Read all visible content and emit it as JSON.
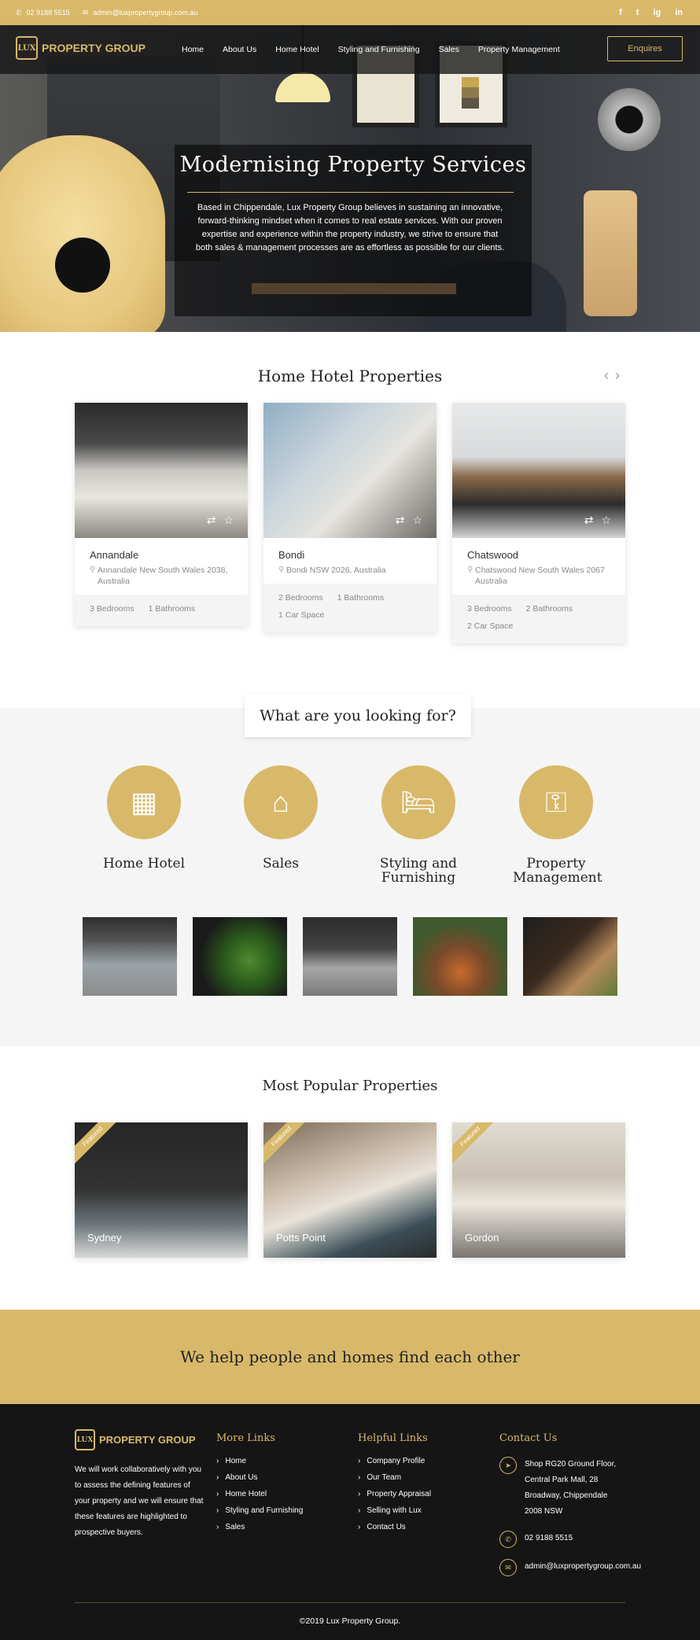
{
  "topbar": {
    "phone": "02 9188 5515",
    "email": "admin@luxpropertygroup.com.au",
    "social": [
      "f",
      "t",
      "ig",
      "in"
    ]
  },
  "header": {
    "logo_mark": "LUX",
    "logo_text": "PROPERTY GROUP",
    "nav": [
      "Home",
      "About Us",
      "Home Hotel",
      "Styling and Furnishing",
      "Sales",
      "Property Management"
    ],
    "cta": "Enquires"
  },
  "hero": {
    "title": "Modernising Property Services",
    "text": "Based in Chippendale, Lux Property Group believes in sustaining an innovative, forward-thinking mindset when it comes to real estate services. With our proven expertise and experience within the property industry, we strive to ensure that both sales & management processes are as effortless as possible for our clients."
  },
  "home_hotel": {
    "title": "Home Hotel Properties",
    "cards": [
      {
        "name": "Annandale",
        "address": "Annandale New South Wales 2038, Australia",
        "features": [
          "3 Bedrooms",
          "1 Bathrooms"
        ]
      },
      {
        "name": "Bondi",
        "address": "Bondi NSW 2026, Australia",
        "features": [
          "2 Bedrooms",
          "1 Bathrooms",
          "1 Car Space"
        ]
      },
      {
        "name": "Chatswood",
        "address": "Chatswood New South Wales 2067 Australia",
        "features": [
          "3 Bedrooms",
          "2 Bathrooms",
          "2 Car Space"
        ]
      }
    ]
  },
  "looking": {
    "title": "What are you looking for?",
    "categories": [
      {
        "label": "Home Hotel",
        "icon": "building-icon"
      },
      {
        "label": "Sales",
        "icon": "house-icon"
      },
      {
        "label": "Styling and Furnishing",
        "icon": "bed-icon"
      },
      {
        "label": "Property Management",
        "icon": "key-icon"
      }
    ]
  },
  "popular": {
    "title": "Most Popular Properties",
    "ribbon": "Featured",
    "items": [
      "Sydney",
      "Potts Point",
      "Gordon"
    ]
  },
  "banner": {
    "text": "We help people and homes find each other"
  },
  "footer": {
    "logo_mark": "LUX",
    "logo_text": "PROPERTY GROUP",
    "about": "We will work collaboratively with you to assess the defining features of your property and we will ensure that these features are highlighted to prospective buyers.",
    "more_links_title": "More Links",
    "more_links": [
      "Home",
      "About Us",
      "Home Hotel",
      "Styling and Furnishing",
      "Sales"
    ],
    "helpful_title": "Helpful Links",
    "helpful_links": [
      "Company Profile",
      "Our Team",
      "Property Appraisal",
      "Selling with Lux",
      "Contact Us"
    ],
    "contact_title": "Contact Us",
    "address": "Shop RG20 Ground Floor, Central Park Mall, 28 Broadway, Chippendale 2008 NSW",
    "phone": "02 9188 5515",
    "email": "admin@luxpropertygroup.com.au",
    "copyright": "©2019 Lux Property Group."
  },
  "colors": {
    "accent": "#d8b96a",
    "dark": "#151515",
    "light_bg": "#f5f5f5"
  }
}
